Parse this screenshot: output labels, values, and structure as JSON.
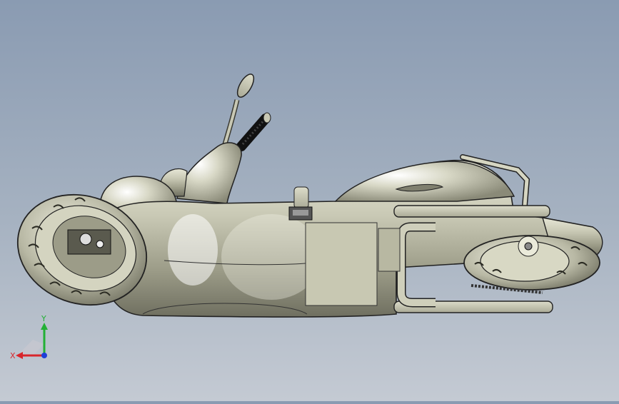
{
  "viewport": {
    "background_top": "#8a9bb2",
    "background_bottom": "#c4cad3",
    "model_name": "scooter-3d-model",
    "render_style": "shaded-with-edges"
  },
  "triad": {
    "x_label": "X",
    "y_label": "Y",
    "x_color": "#d8262c",
    "y_color": "#22b035",
    "z_color": "#1f3fd8"
  }
}
